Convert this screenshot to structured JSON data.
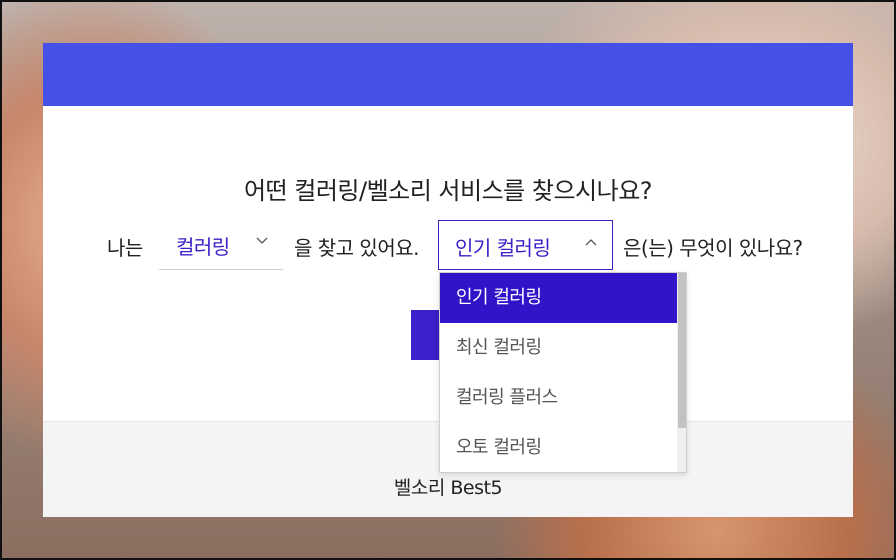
{
  "modal": {
    "question": "어떤 컬러링/벨소리 서비스를 찾으시나요?",
    "sentence": {
      "prefix": "나는",
      "service_select": {
        "value": "컬러링",
        "chevron": "chevron-down"
      },
      "middle": "을 찾고 있어요.",
      "category_select": {
        "value": "인기 컬러링",
        "chevron": "chevron-up"
      },
      "suffix": "은(는) 무엇이 있나요?"
    },
    "submit_button": {
      "label": ""
    },
    "footer": {
      "label": "벨소리 Best5"
    },
    "colors": {
      "header": "#4550e6",
      "accent": "#3b21c9",
      "selected_option": "#3213c8"
    }
  },
  "dropdown": {
    "options": [
      {
        "label": "인기 컬러링",
        "selected": true
      },
      {
        "label": "최신 컬러링",
        "selected": false
      },
      {
        "label": "컬러링 플러스",
        "selected": false
      },
      {
        "label": "오토 컬러링",
        "selected": false
      }
    ]
  }
}
